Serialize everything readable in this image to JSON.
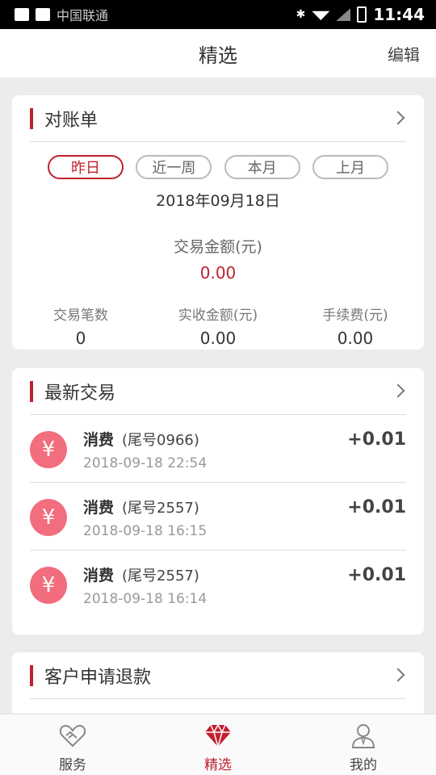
{
  "status_bar": {
    "carrier": "中国联通",
    "time": "11:44"
  },
  "header": {
    "title": "精选",
    "edit_label": "编辑"
  },
  "statement": {
    "title": "对账单",
    "tabs": [
      {
        "label": "昨日",
        "active": true
      },
      {
        "label": "近一周",
        "active": false
      },
      {
        "label": "本月",
        "active": false
      },
      {
        "label": "上月",
        "active": false
      }
    ],
    "date": "2018年09月18日",
    "amount_label": "交易金额(元)",
    "amount_value": "0.00",
    "stats": [
      {
        "label": "交易笔数",
        "value": "0"
      },
      {
        "label": "实收金额(元)",
        "value": "0.00"
      },
      {
        "label": "手续费(元)",
        "value": "0.00"
      }
    ]
  },
  "transactions": {
    "title": "最新交易",
    "items": [
      {
        "icon": "yen-icon",
        "type": "消费",
        "tail": "(尾号0966)",
        "time": "2018-09-18 22:54",
        "amount": "+0.01"
      },
      {
        "icon": "yen-icon",
        "type": "消费",
        "tail": "(尾号2557)",
        "time": "2018-09-18 16:15",
        "amount": "+0.01"
      },
      {
        "icon": "yen-icon",
        "type": "消费",
        "tail": "(尾号2557)",
        "time": "2018-09-18 16:14",
        "amount": "+0.01"
      }
    ]
  },
  "refunds": {
    "title": "客户申请退款"
  },
  "bottom_nav": [
    {
      "label": "服务",
      "icon": "handshake-icon",
      "active": false
    },
    {
      "label": "精选",
      "icon": "diamond-icon",
      "active": true
    },
    {
      "label": "我的",
      "icon": "user-icon",
      "active": false
    }
  ],
  "colors": {
    "accent": "#c0202f",
    "icon_bg": "#f26d7d"
  }
}
